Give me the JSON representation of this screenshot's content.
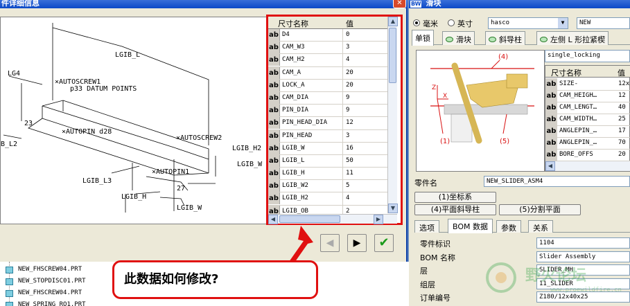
{
  "left_dialog": {
    "title": "件详细信息",
    "close_glyph": "✕",
    "drawing_labels": {
      "lgib_l": "LGIB_L",
      "lg4": "LG4",
      "autoscrew1": "×AUTOSCREW1",
      "p33": "p33 DATUM POINTS",
      "autoscrew2": "×AUTOSCREW2",
      "d23": "23",
      "autopin_d28": "×AUTOPIN d28",
      "lgib_l2": "B_L2",
      "lgib_h2": "LGIB_H2",
      "lgib_w": "LGIB_W",
      "autopin1": "×AUTOPIN1",
      "lgib_l3": "LGIB_L3",
      "d27": "27",
      "lgib_h": "LGIB_H",
      "lgib_w_bottom": "LGIB_W"
    },
    "grid": {
      "col_name": "尺寸名称",
      "col_value": "值",
      "rows": [
        {
          "tag": "ab",
          "name": "D4",
          "value": "0"
        },
        {
          "tag": "ab",
          "name": "CAM_W3",
          "value": "3"
        },
        {
          "tag": "ab",
          "name": "CAM_H2",
          "value": "4"
        },
        {
          "tag": "ab",
          "name": "CAM_A",
          "value": "20"
        },
        {
          "tag": "ab",
          "name": "LOCK_A",
          "value": "20"
        },
        {
          "tag": "ab",
          "name": "CAM_DIA",
          "value": "9"
        },
        {
          "tag": "ab",
          "name": "PIN_DIA",
          "value": "9"
        },
        {
          "tag": "ab",
          "name": "PIN_HEAD_DIA",
          "value": "12"
        },
        {
          "tag": "ab",
          "name": "PIN_HEAD",
          "value": "3"
        },
        {
          "tag": "ab",
          "name": "LGIB_W",
          "value": "16"
        },
        {
          "tag": "ab",
          "name": "LGIB_L",
          "value": "50"
        },
        {
          "tag": "ab",
          "name": "LGIB_H",
          "value": "11"
        },
        {
          "tag": "ab",
          "name": "LGIB_W2",
          "value": "5"
        },
        {
          "tag": "ab",
          "name": "LGIB_H2",
          "value": "4"
        },
        {
          "tag": "ab",
          "name": "LGIB_OB",
          "value": "2"
        }
      ]
    },
    "nav": {
      "prev_glyph": "◀",
      "next_glyph": "▶",
      "ok_glyph": "✔"
    }
  },
  "tree": {
    "items": [
      "NEW_FHSCREW04.PRT",
      "NEW_STOPDISC01.PRT",
      "NEW_FHSCREW04.PRT",
      "NEW_SPRING_RO1.PRT"
    ]
  },
  "callout": {
    "text": "此数据如何修改?"
  },
  "right_dialog": {
    "title_badge": "BW",
    "title": "滑块",
    "unit_mm": "毫米",
    "unit_inch": "英寸",
    "vendor": "hasco",
    "mode": "NEW",
    "tabs": [
      "单锁",
      "滑块",
      "斜导柱",
      "左侧 L 形拉紧楔"
    ],
    "config_name": "single_locking",
    "preview_labels": {
      "l4": "(4)",
      "l1": "(1)",
      "l5": "(5)",
      "z": "Z",
      "x": "X"
    },
    "param_grid": {
      "col_name": "尺寸名称",
      "col_value": "值",
      "rows": [
        {
          "tag": "ab",
          "name": "SIZE-",
          "value": "12x"
        },
        {
          "tag": "ab",
          "name": "CAM_HEIGH…",
          "value": "12"
        },
        {
          "tag": "ab",
          "name": "CAM_LENGT…",
          "value": "40"
        },
        {
          "tag": "ab",
          "name": "CAM_WIDTH…",
          "value": "25"
        },
        {
          "tag": "ab",
          "name": "ANGLEPIN_…",
          "value": "17"
        },
        {
          "tag": "ab",
          "name": "ANGLEPIN_…",
          "value": "70"
        },
        {
          "tag": "ab",
          "name": "BORE_OFFS",
          "value": "20"
        }
      ]
    },
    "part_name_label": "零件名",
    "part_name": "NEW_SLIDER_ASM4",
    "buttons": {
      "csys": "(1)坐标系",
      "plane": "(4)平面斜导柱",
      "split": "(5)分割平面"
    },
    "tabs2": [
      "选项",
      "BOM 数据",
      "参数",
      "关系"
    ],
    "form": [
      {
        "label": "零件标识",
        "value": "1104"
      },
      {
        "label": "BOM 名称",
        "value": "Slider Assembly"
      },
      {
        "label": "层",
        "value": "SLIDER_MH"
      },
      {
        "label": "组层",
        "value": "11_SLIDER"
      },
      {
        "label": "订单编号",
        "value": "Z180/12x40x25"
      }
    ],
    "watermark": {
      "text": "野火论坛",
      "sub": "www.proewildfire.cn"
    }
  },
  "colors": {
    "highlight": "#e01010",
    "title_bar": "#0c49c7",
    "ok_green": "#1a9a1a"
  }
}
